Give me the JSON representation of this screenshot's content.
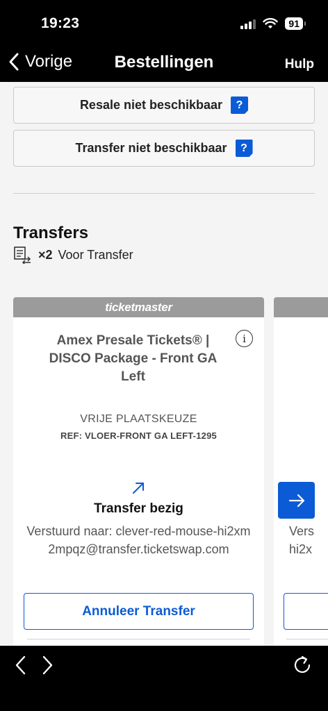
{
  "status_bar": {
    "time": "19:23",
    "battery": "91"
  },
  "nav": {
    "back_label": "Vorige",
    "title": "Bestellingen",
    "help_label": "Hulp"
  },
  "actions": {
    "resale_label": "Resale niet beschikbaar",
    "transfer_label": "Transfer niet beschikbaar",
    "help_badge": "?"
  },
  "transfers": {
    "title": "Transfers",
    "count": "×2",
    "count_label": "Voor Transfer"
  },
  "ticket": {
    "brand": "ticketmaster",
    "info_symbol": "i",
    "event_name": "Amex Presale Tickets® | DISCO Package - Front GA Left",
    "seat_type": "VRIJE PLAATSKEUZE",
    "reference": "REF: VLOER-FRONT GA LEFT-1295",
    "status": "Transfer bezig",
    "sent_to": "Verstuurd naar: clever-red-mouse-hi2xm2mpqz@transfer.ticketswap.com",
    "cancel_label": "Annuleer Transfer"
  },
  "next_ticket_preview": {
    "text_line1": "Vers",
    "text_line2": "hi2x"
  },
  "colors": {
    "accent": "#0b5bd6",
    "header_gray": "#9b9b9b",
    "background": "#f4f4f4"
  },
  "icons": {
    "back": "chevron-left-icon",
    "help": "question-icon",
    "transfer": "ticket-transfer-icon",
    "info": "info-icon",
    "transfer_status": "arrow-up-right-icon",
    "next": "arrow-right-icon",
    "browser_back": "chevron-left-icon",
    "browser_forward": "chevron-right-icon",
    "reload": "reload-icon"
  }
}
